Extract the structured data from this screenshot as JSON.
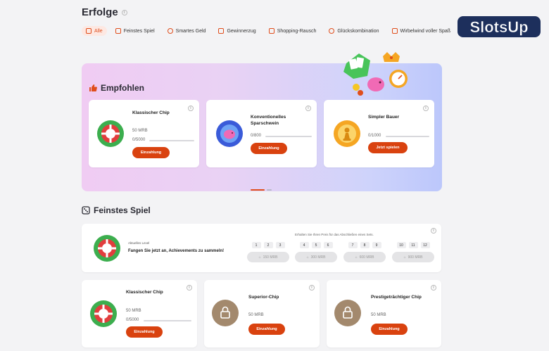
{
  "page": {
    "title": "Erfolge"
  },
  "tabs": [
    {
      "label": "Alle",
      "active": true,
      "icon": "fire-icon"
    },
    {
      "label": "Feinstes Spiel",
      "icon": "dice-icon"
    },
    {
      "label": "Smartes Geld",
      "icon": "coins-icon"
    },
    {
      "label": "Gewinnerzug",
      "icon": "trophy-icon"
    },
    {
      "label": "Shopping-Rausch",
      "icon": "cart-icon"
    },
    {
      "label": "Glückskombination",
      "icon": "clover-icon"
    },
    {
      "label": "Wirbelwind voller Spaß",
      "icon": "car-icon"
    }
  ],
  "brand": {
    "logo_text": "SlotsUp"
  },
  "empfohlen": {
    "heading": "Empfohlen",
    "cards": [
      {
        "title": "Klassischer Chip",
        "reward": "50 MRB",
        "progress": "0/5000",
        "progress_value": 0,
        "button": "Einzahlung"
      },
      {
        "title": "Konventionelles Sparschwein",
        "reward": "",
        "progress": "0/800",
        "progress_value": 0,
        "button": "Einzahlung"
      },
      {
        "title": "Simpler Bauer",
        "reward": "",
        "progress": "0/1000",
        "progress_value": 0,
        "button": "Jetzt spielen"
      }
    ]
  },
  "feinstes": {
    "heading": "Feinstes Spiel",
    "level": {
      "label": "Aktuelles Level",
      "message": "Fangen Sie jetzt an, Achievements zu sammeln!",
      "hint": "Erhalten Sie Ihren Preis für das Abschließen eines Sets.",
      "groups": [
        {
          "levels": [
            "1",
            "2",
            "3"
          ],
          "reward": "150 MRB"
        },
        {
          "levels": [
            "4",
            "5",
            "6"
          ],
          "reward": "300 MRB"
        },
        {
          "levels": [
            "7",
            "8",
            "9"
          ],
          "reward": "600 MRB"
        },
        {
          "levels": [
            "10",
            "11",
            "12"
          ],
          "reward": "900 MRB"
        }
      ]
    },
    "cards": [
      {
        "title": "Klassischer Chip",
        "reward": "50 MRB",
        "progress": "0/5000",
        "button": "Einzahlung"
      },
      {
        "title": "Superior-Chip",
        "reward": "50 MRB",
        "button": "Einzahlung"
      },
      {
        "title": "Prestigeträchtiger Chip",
        "reward": "50 MRB",
        "button": "Einzahlung"
      }
    ]
  }
}
